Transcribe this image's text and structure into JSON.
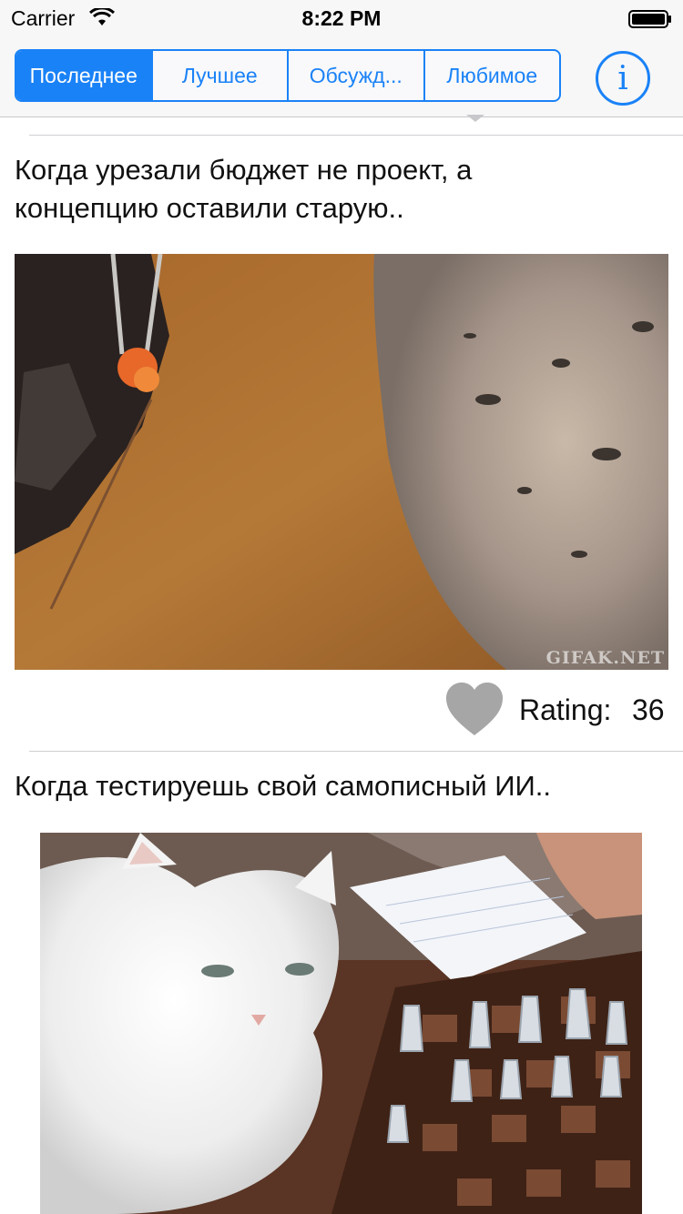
{
  "status_bar": {
    "carrier": "Carrier",
    "time": "8:22 PM",
    "wifi_icon": "wifi-icon",
    "battery_icon": "battery-icon"
  },
  "nav": {
    "tabs": [
      {
        "label": "Последнее",
        "active": true
      },
      {
        "label": "Лучшее",
        "active": false
      },
      {
        "label": "Обсужд...",
        "active": false
      },
      {
        "label": "Любимое",
        "active": false
      }
    ],
    "info_label": "i",
    "accent_color": "#1a82f7"
  },
  "posts": [
    {
      "title": "Когда урезали бюджет не проект, а концепцию оставили старую..",
      "watermark": "GIFAK.NET",
      "rating_label": "Rating:",
      "rating_value": "36",
      "heart_icon": "heart-icon"
    },
    {
      "title": "Когда тестируешь свой самописный ИИ.."
    }
  ]
}
